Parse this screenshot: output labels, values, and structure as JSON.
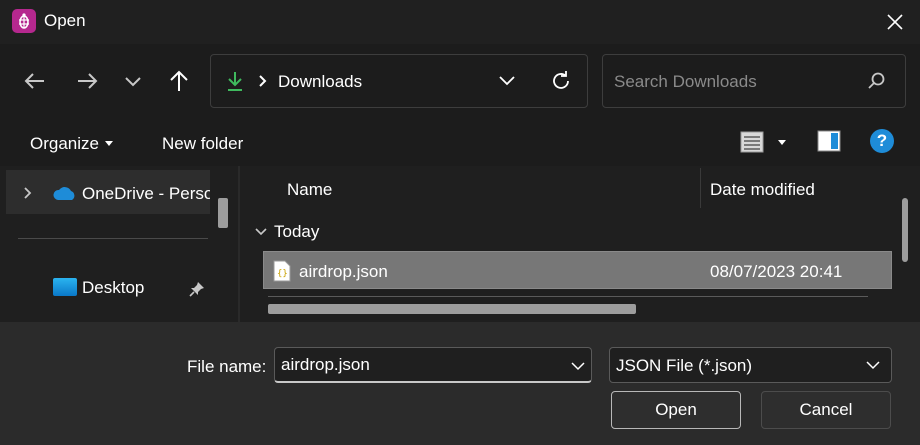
{
  "window": {
    "title": "Open"
  },
  "address": {
    "crumb": "Downloads"
  },
  "search": {
    "placeholder": "Search Downloads"
  },
  "commands": {
    "organize": "Organize",
    "new_folder": "New folder"
  },
  "nav_pane": {
    "onedrive_label": "OneDrive - Personal",
    "desktop_label": "Desktop"
  },
  "file_list": {
    "columns": {
      "name": "Name",
      "date_modified": "Date modified"
    },
    "groups": [
      {
        "label": "Today",
        "files": [
          {
            "name": "airdrop.json",
            "date": "08/07/2023 20:41"
          }
        ]
      }
    ]
  },
  "bottom": {
    "file_name_label": "File name:",
    "file_name_value": "airdrop.json",
    "file_type_value": "JSON File (*.json)",
    "open_label": "Open",
    "cancel_label": "Cancel"
  },
  "colors": {
    "app_icon": "#b5288e",
    "help": "#1e8cd8",
    "download_icon": "#3fb95e",
    "selection": "#777777"
  }
}
